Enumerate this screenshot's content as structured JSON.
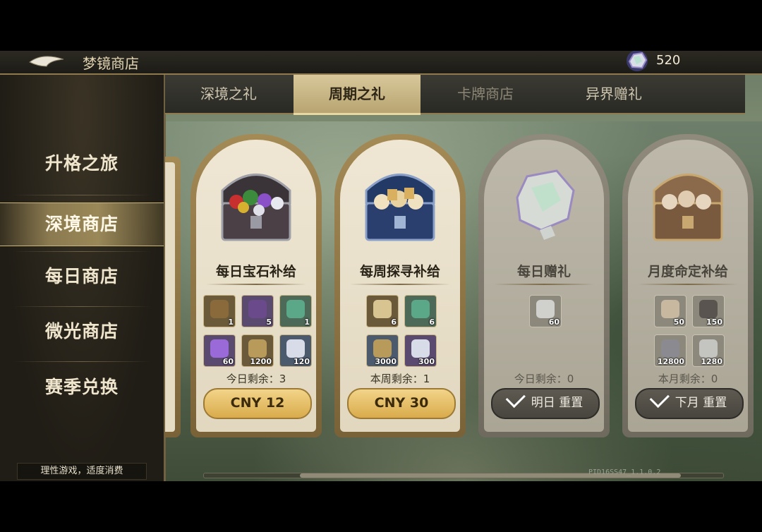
{
  "topbar": {
    "title": "梦镜商店",
    "currency_value": "520"
  },
  "sidebar": {
    "items": [
      {
        "label": "升格之旅",
        "active": false
      },
      {
        "label": "深境商店",
        "active": true
      },
      {
        "label": "每日商店",
        "active": false
      },
      {
        "label": "微光商店",
        "active": false
      },
      {
        "label": "赛季兑换",
        "active": false
      }
    ],
    "notice": "理性游戏，适度消费"
  },
  "tabs": [
    {
      "label": "深境之礼"
    },
    {
      "label": "周期之礼"
    },
    {
      "label": "卡牌商店"
    },
    {
      "label": "异界赠礼"
    }
  ],
  "cards": [
    {
      "title": "每日宝石补给",
      "items": [
        {
          "icon": "gem-chest-icon",
          "qty": "1"
        },
        {
          "icon": "purple-chest-icon",
          "qty": "5"
        },
        {
          "icon": "green-crystal-icon",
          "qty": "1"
        },
        {
          "icon": "purple-shard-icon",
          "qty": "60"
        },
        {
          "icon": "scroll-icon",
          "qty": "1200"
        },
        {
          "icon": "rainbow-stone-icon",
          "qty": "120"
        }
      ],
      "remaining": "今日剩余：3",
      "button": "CNY 12"
    },
    {
      "title": "每周探寻补给",
      "items": [
        {
          "icon": "gold-star-stone-icon",
          "qty": "6"
        },
        {
          "icon": "green-crystal-icon",
          "qty": "6"
        },
        {
          "icon": "scroll-icon",
          "qty": "3000"
        },
        {
          "icon": "rainbow-stone-icon",
          "qty": "300"
        }
      ],
      "remaining": "本周剩余：1",
      "button": "CNY 30"
    },
    {
      "title": "每日赠礼",
      "items": [
        {
          "icon": "rainbow-stone-icon",
          "qty": "60"
        }
      ],
      "remaining": "今日剩余：0",
      "button": "明日 重置"
    },
    {
      "title": "月度命定补给",
      "items": [
        {
          "icon": "gold-star-stone-icon",
          "qty": "50"
        },
        {
          "icon": "gem-chest-icon",
          "qty": "150"
        },
        {
          "icon": "scroll-icon",
          "qty": "12800"
        },
        {
          "icon": "rainbow-stone-icon",
          "qty": "1280"
        }
      ],
      "remaining": "本月剩余：0",
      "button": "下月 重置"
    }
  ],
  "footer": {
    "build": "PID16SS47_1.1.0.2"
  }
}
